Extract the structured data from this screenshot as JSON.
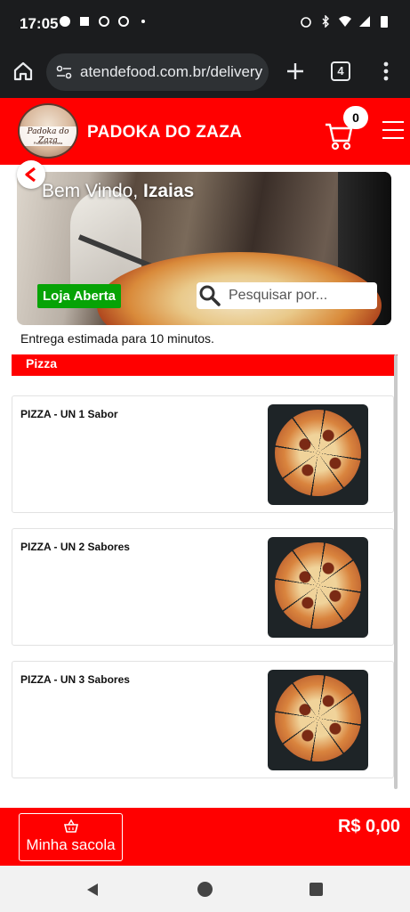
{
  "status_bar": {
    "time": "17:05"
  },
  "browser": {
    "url": "atendefood.com.br/delivery",
    "tab_count": "4"
  },
  "header": {
    "logo_text": "Padoka do Zaza",
    "logo_subtext": "Padaria e Pizzaria",
    "store_name": "PADOKA DO ZAZA",
    "cart_count": "0"
  },
  "banner": {
    "welcome_prefix": "Bem Vindo, ",
    "user_name": "Izaias",
    "status_badge": "Loja Aberta",
    "search_placeholder": "Pesquisar por..."
  },
  "delivery_estimate": "Entrega estimada para 10 minutos.",
  "category": {
    "name": "Pizza"
  },
  "products": [
    {
      "name": "PIZZA - UN 1 Sabor"
    },
    {
      "name": "PIZZA - UN 2 Sabores"
    },
    {
      "name": "PIZZA - UN 3 Sabores"
    }
  ],
  "bag": {
    "label": "Minha sacola",
    "total": "R$ 0,00"
  },
  "colors": {
    "primary": "#ff0000",
    "open_badge": "#06a306",
    "system_bar": "#1b1c1e"
  },
  "icons": [
    "home-icon",
    "tune-icon",
    "plus-icon",
    "tabs-icon",
    "more-vert-icon",
    "cart-icon",
    "hamburger-icon",
    "back-arrow-icon",
    "search-icon",
    "basket-icon"
  ]
}
